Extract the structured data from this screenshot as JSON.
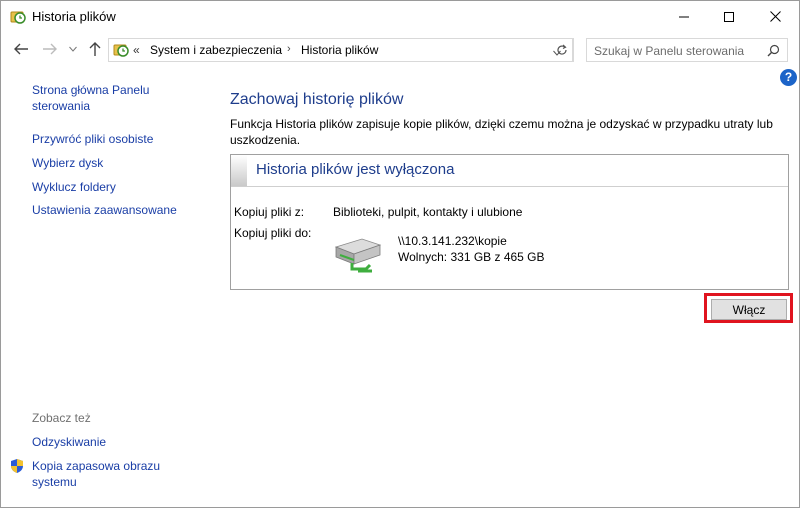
{
  "window": {
    "title": "Historia plików"
  },
  "address_bar": {
    "prefix": "«",
    "crumbs": [
      "System i zabezpieczenia",
      "Historia plików"
    ]
  },
  "search": {
    "placeholder": "Szukaj w Panelu sterowania"
  },
  "help": {
    "label": "?"
  },
  "sidebar": {
    "links": [
      "Strona główna Panelu sterowania",
      "Przywróć pliki osobiste",
      "Wybierz dysk",
      "Wyklucz foldery",
      "Ustawienia zaawansowane"
    ],
    "see_also_label": "Zobacz też",
    "see_also": [
      "Odzyskiwanie",
      "Kopia zapasowa obrazu systemu"
    ]
  },
  "main": {
    "heading": "Zachowaj historię plików",
    "description": "Funkcja Historia plików zapisuje kopie plików, dzięki czemu można je odzyskać w przypadku utraty lub uszkodzenia.",
    "status": {
      "title": "Historia plików jest wyłączona",
      "copy_from_label": "Kopiuj pliki z:",
      "copy_from_value": "Biblioteki, pulpit, kontakty i ulubione",
      "copy_to_label": "Kopiuj pliki do:",
      "drive_path": "\\\\10.3.141.232\\kopie",
      "drive_free": "Wolnych: 331 GB z 465 GB"
    },
    "turn_on_label": "Włącz"
  },
  "colors": {
    "link": "#1a3ea6",
    "heading": "#1e3d8c",
    "highlight": "#e0141f"
  }
}
